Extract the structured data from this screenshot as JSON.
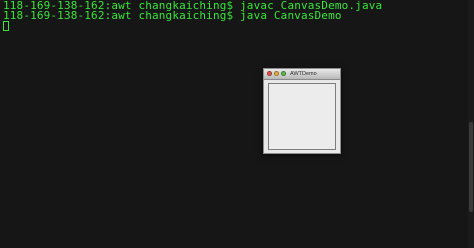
{
  "terminal": {
    "lines": [
      "118-169-138-162:awt changkaiching$ javac CanvasDemo.java",
      "118-169-138-162:awt changkaiching$ java CanvasDemo"
    ],
    "text_color": "#37e637",
    "background_color": "#161616"
  },
  "awt_window": {
    "title": "AWTDemo",
    "buttons": [
      "close-icon",
      "minimize-icon",
      "zoom-icon"
    ]
  }
}
